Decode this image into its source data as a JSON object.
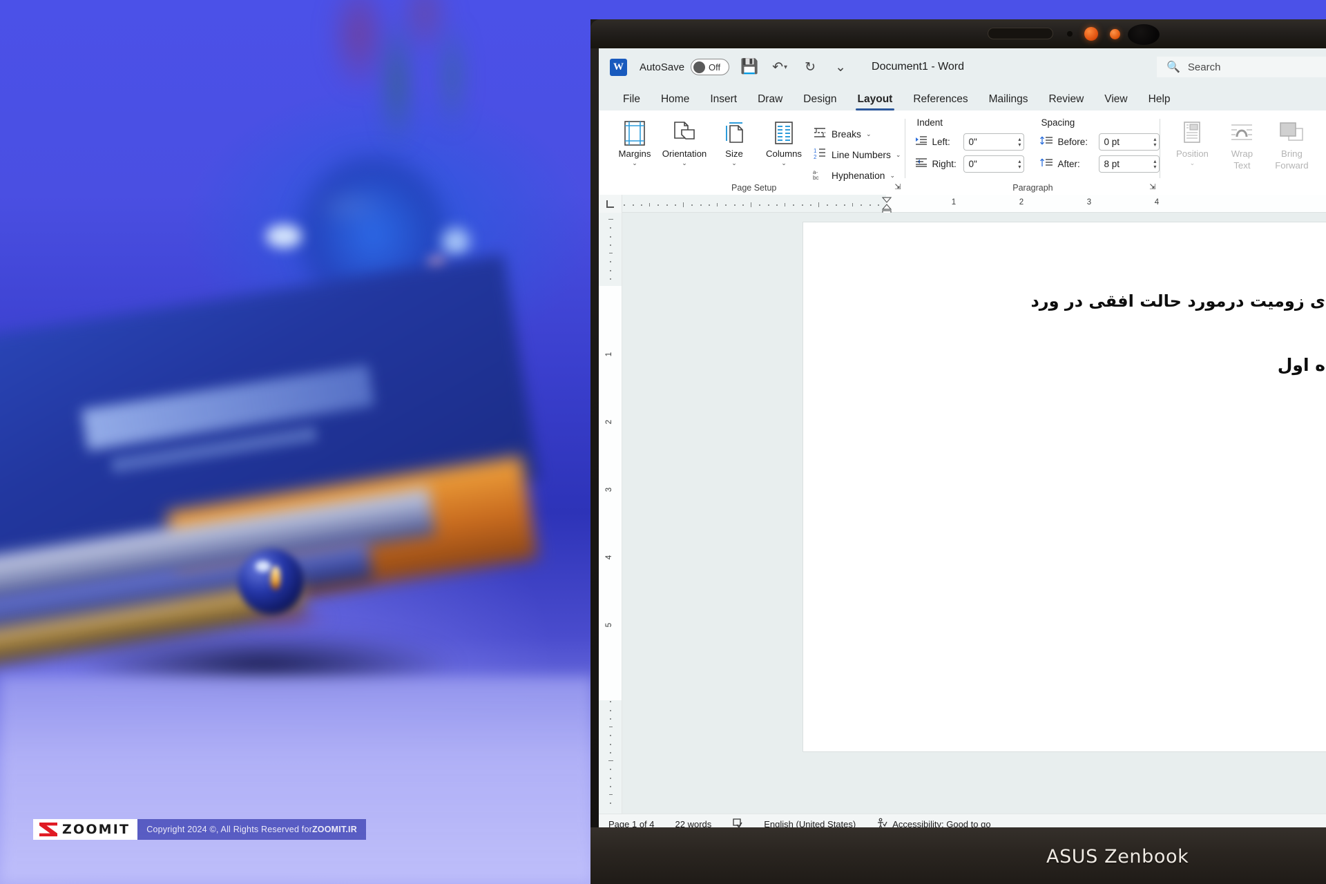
{
  "photo": {
    "watermark": {
      "brand": "ZOOMIT",
      "logo_icon": "zoomit-z-icon",
      "copyright_prefix": "Copyright 2024 ©, All Rights Reserved for ",
      "copyright_brand": "ZOOMIT.IR",
      "logo_color": "#e01b24"
    },
    "laptop_brand": "ASUS Zenbook"
  },
  "titlebar": {
    "app_icon": "W",
    "autosave_label": "AutoSave",
    "autosave_state": "Off",
    "save_icon": "save-icon",
    "undo_icon": "undo-icon",
    "redo_icon": "redo-icon",
    "customize_icon": "customize-quick-access-icon",
    "document_title": "Document1  -  Word"
  },
  "search": {
    "icon": "search-icon",
    "placeholder": "Search"
  },
  "tabs": [
    {
      "label": "File",
      "active": false
    },
    {
      "label": "Home",
      "active": false
    },
    {
      "label": "Insert",
      "active": false
    },
    {
      "label": "Draw",
      "active": false
    },
    {
      "label": "Design",
      "active": false
    },
    {
      "label": "Layout",
      "active": true
    },
    {
      "label": "References",
      "active": false
    },
    {
      "label": "Mailings",
      "active": false
    },
    {
      "label": "Review",
      "active": false
    },
    {
      "label": "View",
      "active": false
    },
    {
      "label": "Help",
      "active": false
    }
  ],
  "ribbon": {
    "page_setup": {
      "group_label": "Page Setup",
      "dialog_launcher": "dialog-launcher-icon",
      "margins": {
        "label": "Margins",
        "icon": "margins-icon",
        "caret": "⌄"
      },
      "orientation": {
        "label": "Orientation",
        "icon": "orientation-icon",
        "caret": "⌄"
      },
      "size": {
        "label": "Size",
        "icon": "page-size-icon",
        "caret": "⌄"
      },
      "columns": {
        "label": "Columns",
        "icon": "columns-icon",
        "caret": "⌄"
      },
      "breaks": {
        "label": "Breaks",
        "icon": "breaks-icon",
        "caret": "⌄"
      },
      "line_numbers": {
        "label": "Line Numbers",
        "icon": "line-numbers-icon",
        "caret": "⌄"
      },
      "hyphenation": {
        "label": "Hyphenation",
        "icon": "hyphenation-icon",
        "caret": "⌄"
      }
    },
    "paragraph": {
      "group_label": "Paragraph",
      "dialog_launcher": "dialog-launcher-icon",
      "indent_heading": "Indent",
      "spacing_heading": "Spacing",
      "indent_left_label": "Left:",
      "indent_left_value": "0\"",
      "indent_right_label": "Right:",
      "indent_right_value": "0\"",
      "spacing_before_label": "Before:",
      "spacing_before_value": "0 pt",
      "spacing_after_label": "After:",
      "spacing_after_value": "8 pt"
    },
    "arrange": {
      "position": {
        "label": "Position",
        "icon": "position-icon",
        "caret": "⌄",
        "disabled": true
      },
      "wrap_text": {
        "label_line1": "Wrap",
        "label_line2": "Text",
        "icon": "wrap-text-icon",
        "caret": "⌄",
        "disabled": true
      },
      "bring_forward": {
        "label_line1": "Bring",
        "label_line2": "Forward",
        "icon": "bring-forward-icon",
        "disabled": true
      }
    }
  },
  "ruler": {
    "tab_stop_icon": "tab-stop-selector-icon",
    "horizontal_numbers": [
      "1",
      "2",
      "3",
      "4"
    ],
    "vertical_numbers": [
      "1",
      "2",
      "3",
      "4",
      "5"
    ],
    "indent_markers": [
      "first-line-indent-marker",
      "hanging-indent-marker",
      "left-indent-marker"
    ]
  },
  "document": {
    "lines": [
      "ی زومیت درمورد حالت افقی در ورد",
      "ه اول"
    ]
  },
  "statusbar": {
    "page": "Page 1 of 4",
    "words": "22 words",
    "proofing_icon": "proofing-errors-icon",
    "language": "English (United States)",
    "accessibility_icon": "accessibility-icon",
    "accessibility": "Accessibility: Good to go"
  }
}
